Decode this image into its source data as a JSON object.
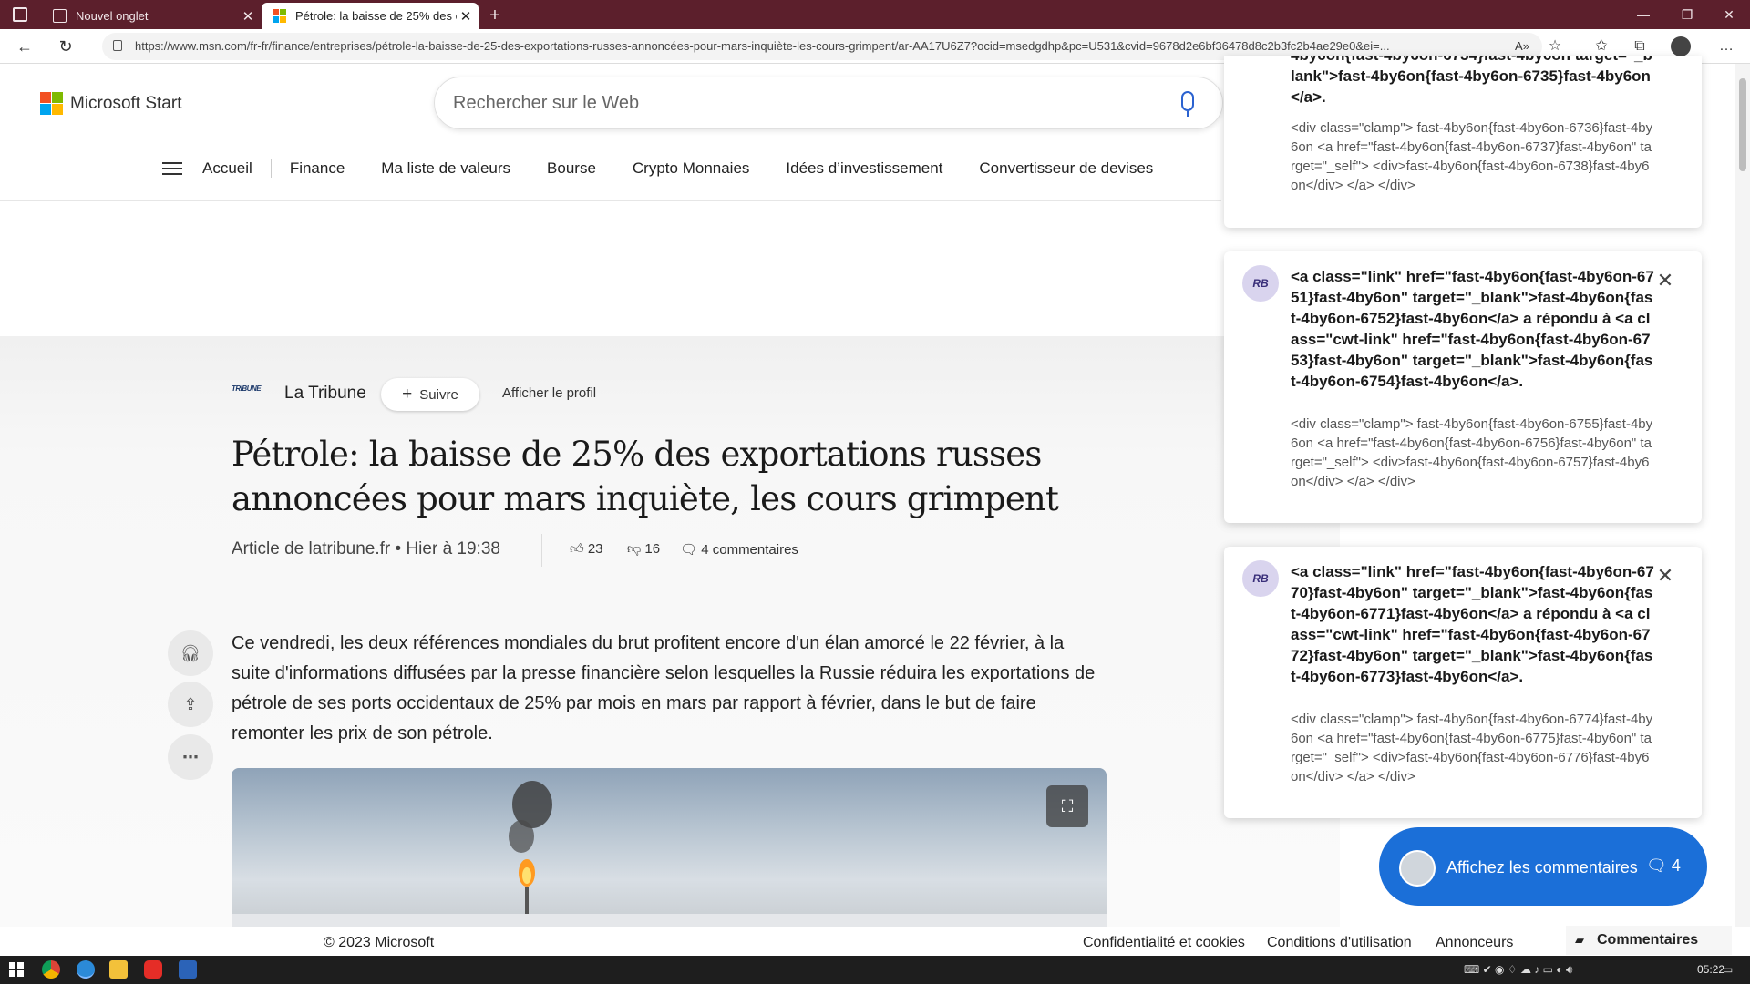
{
  "browser": {
    "tabs": [
      {
        "label": "Nouvel onglet"
      },
      {
        "label": "Pétrole: la baisse de 25% des exportations russes annoncées pour mars inquiète, les cours grimpent"
      }
    ],
    "url": "https://www.msn.com/fr-fr/finance/entreprises/pétrole-la-baisse-de-25-des-exportations-russes-annoncées-pour-mars-inquiète-les-cours-grimpent/ar-AA17U6Z7?ocid=msedgdhp&pc=U531&cvid=9678d2e6bf36478d8c2b3fc2b4ae29e0&ei=..."
  },
  "header": {
    "brand": "Microsoft Start",
    "search_placeholder": "Rechercher sur le Web",
    "nav": [
      "Accueil",
      "Finance",
      "Ma liste de valeurs",
      "Bourse",
      "Crypto Monnaies",
      "Idées d’investissement",
      "Convertisseur de devises"
    ]
  },
  "article": {
    "source_logo": "TRIBUNE",
    "source": "La Tribune",
    "follow": "Suivre",
    "profile": "Afficher le profil",
    "headline": "Pétrole: la baisse de 25% des exportations russes annoncées pour mars inquiète, les cours grimpent",
    "byline": "Article de latribune.fr • Hier à 19:38",
    "likes": "23",
    "dislikes": "16",
    "comments": "4 commentaires",
    "body": "Ce vendredi, les deux références mondiales du brut profitent encore d'un élan amorcé le 22 février, à la suite d'informations diffusées par la presse financière selon lesquelles la Russie réduira les exportations de pétrole de ses ports occidentaux de 25% par mois en mars par rapport à février, dans le but de faire remonter les prix de son pétrole."
  },
  "footer": {
    "copyright": "© 2023 Microsoft",
    "links": [
      "Confidentialité et cookies",
      "Conditions d'utilisation",
      "Annonceurs"
    ],
    "comments_tab": "Commentaires"
  },
  "notifications": [
    {
      "title": "4by6on{fast-4by6on-6734}fast-4by6on target=\"_blank\">fast-4by6on{fast-4by6on-6735}fast-4by6on</a>.",
      "body": "<div class=\"clamp\"> fast-4by6on{fast-4by6on-6736}fast-4by6on <a href=\"fast-4by6on{fast-4by6on-6737}fast-4by6on\" target=\"_self\"> <div>fast-4by6on{fast-4by6on-6738}fast-4by6on</div> </a> </div>"
    },
    {
      "avatar": "RB",
      "title": "<a class=\"link\" href=\"fast-4by6on{fast-4by6on-6751}fast-4by6on\" target=\"_blank\">fast-4by6on{fast-4by6on-6752}fast-4by6on</a> a répondu à <a class=\"cwt-link\" href=\"fast-4by6on{fast-4by6on-6753}fast-4by6on\" target=\"_blank\">fast-4by6on{fast-4by6on-6754}fast-4by6on</a>.",
      "body": "<div class=\"clamp\"> fast-4by6on{fast-4by6on-6755}fast-4by6on <a href=\"fast-4by6on{fast-4by6on-6756}fast-4by6on\" target=\"_self\"> <div>fast-4by6on{fast-4by6on-6757}fast-4by6on</div> </a> </div>"
    },
    {
      "avatar": "RB",
      "title": "<a class=\"link\" href=\"fast-4by6on{fast-4by6on-6770}fast-4by6on\" target=\"_blank\">fast-4by6on{fast-4by6on-6771}fast-4by6on</a> a répondu à <a class=\"cwt-link\" href=\"fast-4by6on{fast-4by6on-6772}fast-4by6on\" target=\"_blank\">fast-4by6on{fast-4by6on-6773}fast-4by6on</a>.",
      "body": "<div class=\"clamp\"> fast-4by6on{fast-4by6on-6774}fast-4by6on <a href=\"fast-4by6on{fast-4by6on-6775}fast-4by6on\" target=\"_self\"> <div>fast-4by6on{fast-4by6on-6776}fast-4by6on</div> </a> </div>"
    }
  ],
  "show_comments": {
    "label": "Affichez les commentaires",
    "count": "4"
  },
  "taskbar": {
    "time": "05:22"
  },
  "colors": {
    "titlebar": "#5c1f2c",
    "accent": "#1b6fd8",
    "ms_red": "#f25022",
    "ms_green": "#7fba00",
    "ms_blue": "#00a4ef",
    "ms_yellow": "#ffb900"
  }
}
